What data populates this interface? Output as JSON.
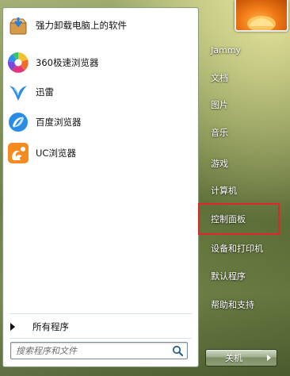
{
  "pinned": [
    {
      "label": "强力卸载电脑上的软件",
      "icon": "uninstall-box-icon"
    },
    {
      "label": "360极速浏览器",
      "icon": "360-browser-icon"
    },
    {
      "label": "迅雷",
      "icon": "thunder-bird-icon"
    },
    {
      "label": "百度浏览器",
      "icon": "baidu-browser-icon"
    },
    {
      "label": "UC浏览器",
      "icon": "uc-browser-icon"
    }
  ],
  "all_programs": "所有程序",
  "search": {
    "placeholder": "搜索程序和文件"
  },
  "right_items": [
    "Jammy",
    "文档",
    "图片",
    "音乐",
    "游戏",
    "计算机",
    "控制面板",
    "设备和打印机",
    "默认程序",
    "帮助和支持"
  ],
  "highlight_color": "#e0262c",
  "shutdown": {
    "label": "关机"
  }
}
